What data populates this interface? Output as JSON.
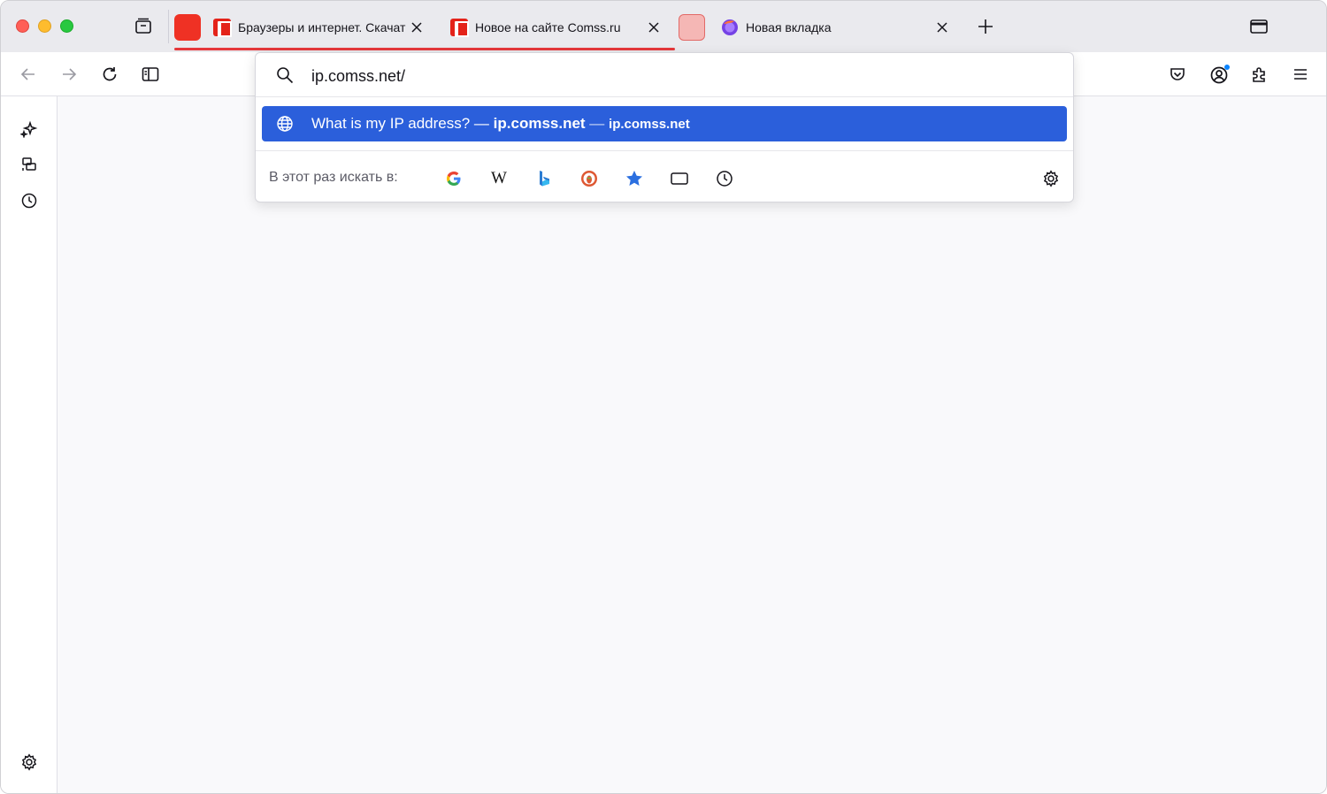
{
  "tabs": [
    {
      "title": "Браузеры и интернет. Скачать",
      "close": "close"
    },
    {
      "title": "Новое на сайте Comss.ru",
      "close": "close"
    },
    {
      "title": "Новая вкладка",
      "close": "close"
    }
  ],
  "urlbar": {
    "value": "ip.comss.net/"
  },
  "suggestion": {
    "title": "What is my IP address?",
    "dash1": " — ",
    "domain": "ip.comss.net",
    "dash2": " — ",
    "url": "ip.comss.net"
  },
  "search_shortcuts": {
    "label": "В этот раз искать в:",
    "engines": [
      "google-icon",
      "wikipedia-icon",
      "bing-icon",
      "duckduckgo-icon",
      "bookmarks-icon",
      "tabs-icon",
      "history-icon"
    ]
  },
  "colors": {
    "accent": "#2b5fdb",
    "tab_group": "#e5383b",
    "comss_red": "#e4231a"
  }
}
